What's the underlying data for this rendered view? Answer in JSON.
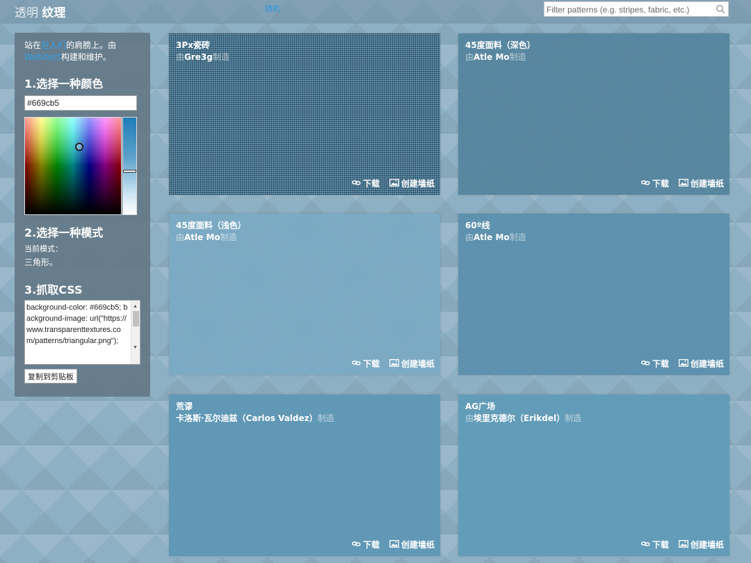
{
  "header": {
    "logo_part1": "透明",
    "logo_part2": "纹理",
    "link": "随机",
    "search_placeholder": "Filter patterns (e.g. stripes, fabric, etc.)"
  },
  "sidebar": {
    "intro_pre": "站在",
    "intro_link1": "巨人们",
    "intro_mid": "的肩膀上。由",
    "intro_link2": "Webitect",
    "intro_post": "构建和维护。",
    "step1": "1.选择一种颜色",
    "color_value": "#669cb5",
    "step2": "2.选择一种模式",
    "current_mode_label": "当前模式：",
    "current_mode_value": "三角形。",
    "step3": "3.抓取CSS",
    "css_text": "background-color: #669cb5; background-image: url(\"https://www.transparenttextures.com/patterns/triangular.png\");",
    "copy_button": "复制到剪贴板"
  },
  "actions": {
    "download": "下载",
    "wallpaper": "创建墙纸"
  },
  "cards": [
    {
      "title": "3Px瓷砖",
      "by": "由",
      "author": "Gre3g",
      "made": "制造"
    },
    {
      "title": "45度面料（深色）",
      "by": "由",
      "author": "Atle Mo",
      "made": "制造"
    },
    {
      "title": "45度面料（浅色）",
      "by": "由",
      "author": "Atle Mo",
      "made": "制造"
    },
    {
      "title": "60º线",
      "by": "由",
      "author": "Atle Mo",
      "made": "制造"
    },
    {
      "title": "荒谬",
      "by": "",
      "author": "卡洛斯·瓦尔迪兹（Carlos Valdez）",
      "made": "制造"
    },
    {
      "title": "AG广场",
      "by": "由",
      "author": "埃里克德尔（Erikdel）",
      "made": "制造"
    }
  ],
  "colors": {
    "accent_link": "#2ea3ee",
    "base": "#669cb5"
  }
}
